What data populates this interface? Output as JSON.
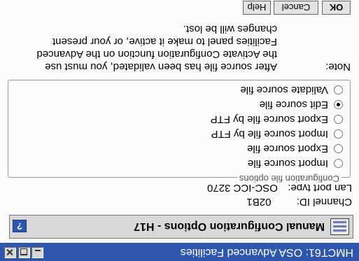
{
  "window": {
    "title": "HMCT61: OSA Advanced Facilities"
  },
  "header": {
    "title": "Manual Configuration Options - H17",
    "help_label": "?"
  },
  "fields": {
    "channel_id_label": "Channel ID:",
    "channel_id_value": "02B1",
    "lan_port_label": "Lan port type:",
    "lan_port_value": "OSC-ICC 3270"
  },
  "options": {
    "legend": "Configuration file options",
    "items": [
      {
        "label": "Import source file",
        "selected": false
      },
      {
        "label": "Export source file",
        "selected": false
      },
      {
        "label": "Import source file by FTP",
        "selected": false
      },
      {
        "label": "Export source file by FTP",
        "selected": false
      },
      {
        "label": "Edit source file",
        "selected": true
      },
      {
        "label": "Validate source file",
        "selected": false
      }
    ]
  },
  "note": {
    "label": "Note:",
    "lines": [
      "After source file has been validated, you must use",
      "the Activate Configuration function on the Advanced",
      "Facilities panel to make it active, or your present",
      "changes will be lost."
    ]
  },
  "buttons": {
    "ok": "OK",
    "cancel": "Cancel",
    "help": "Help"
  }
}
